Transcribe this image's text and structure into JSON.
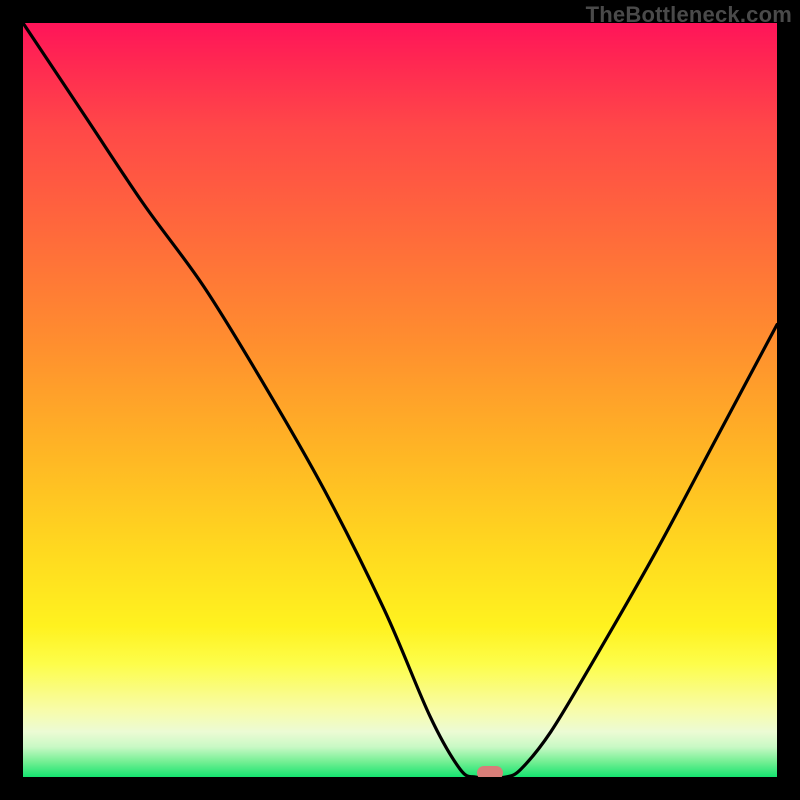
{
  "watermark": "TheBottleneck.com",
  "colors": {
    "frame_background": "#000000",
    "curve_stroke": "#000000",
    "marker_fill": "#d87e79",
    "watermark_text": "#4a4a4a"
  },
  "chart_data": {
    "type": "line",
    "title": "",
    "xlabel": "",
    "ylabel": "",
    "xlim": [
      0,
      100
    ],
    "ylim": [
      0,
      100
    ],
    "x": [
      0,
      8,
      16,
      24,
      32,
      40,
      48,
      54,
      58,
      60,
      62,
      64,
      66,
      70,
      76,
      84,
      92,
      100
    ],
    "values": [
      100,
      88,
      76,
      65,
      52,
      38,
      22,
      8,
      1,
      0,
      0,
      0,
      1,
      6,
      16,
      30,
      45,
      60
    ],
    "minimum_marker": {
      "x": 62,
      "y": 0
    },
    "background_gradient_stops": [
      {
        "pos": 0.0,
        "color": "#ff1459"
      },
      {
        "pos": 0.14,
        "color": "#ff4848"
      },
      {
        "pos": 0.42,
        "color": "#ff8d2f"
      },
      {
        "pos": 0.7,
        "color": "#ffd91f"
      },
      {
        "pos": 0.85,
        "color": "#fdfd4a"
      },
      {
        "pos": 0.94,
        "color": "#ecfbd4"
      },
      {
        "pos": 1.0,
        "color": "#15e36f"
      }
    ]
  }
}
